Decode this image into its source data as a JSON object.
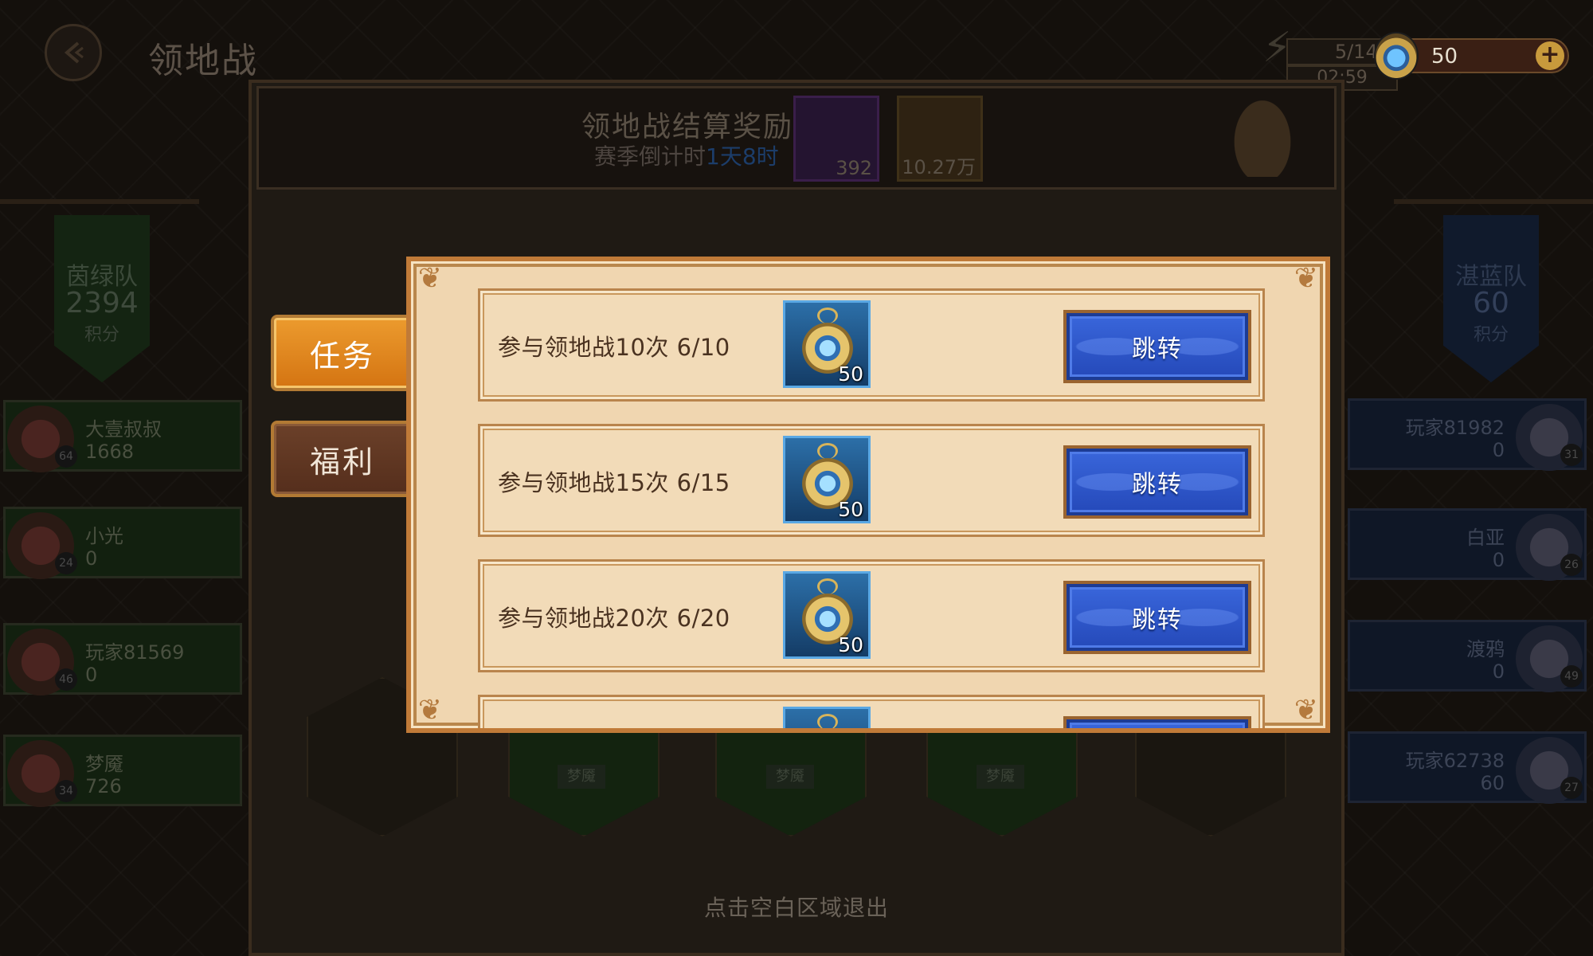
{
  "header": {
    "title": "领地战",
    "energy_count": "5/140",
    "energy_timer": "02:59",
    "currency_value": "50"
  },
  "settlement": {
    "title": "领地战结算奖励",
    "season_label": "赛季倒计时",
    "season_time": "1天8时",
    "rewards": [
      {
        "count": "392",
        "icon": "purple-gem-icon"
      },
      {
        "count": "10.27万",
        "icon": "gold-coin-icon"
      }
    ]
  },
  "teams": {
    "green": {
      "name": "茵绿队",
      "score": "2394",
      "unit": "积分"
    },
    "blue": {
      "name": "湛蓝队",
      "score": "60",
      "unit": "积分"
    }
  },
  "players_green": [
    {
      "name": "大壹叔叔",
      "score": "1668",
      "level": "64"
    },
    {
      "name": "小光",
      "score": "0",
      "level": "24"
    },
    {
      "name": "玩家81569",
      "score": "0",
      "level": "46"
    },
    {
      "name": "梦魇",
      "score": "726",
      "level": "34"
    }
  ],
  "players_blue": [
    {
      "name": "玩家81982",
      "score": "0",
      "level": "31"
    },
    {
      "name": "白亚",
      "score": "0",
      "level": "26"
    },
    {
      "name": "渡鸦",
      "score": "0",
      "level": "49"
    },
    {
      "name": "玩家62738",
      "score": "60",
      "level": "27"
    }
  ],
  "hex_labels": [
    "梦魇",
    "梦魇",
    "梦魇"
  ],
  "tabs": [
    {
      "label": "任务",
      "active": true
    },
    {
      "label": "福利",
      "active": false
    }
  ],
  "tasks": [
    {
      "desc": "参与领地战10次 6/10",
      "reward_qty": "50",
      "button": "跳转"
    },
    {
      "desc": "参与领地战15次 6/15",
      "reward_qty": "50",
      "button": "跳转"
    },
    {
      "desc": "参与领地战20次 6/20",
      "reward_qty": "50",
      "button": "跳转"
    }
  ],
  "exit_hint": "点击空白区域退出",
  "colors": {
    "tab_active": "#e58a22",
    "tab_inactive": "#5e3422",
    "panel_bg": "#f0d6b0",
    "button_blue": "#2e5ad0"
  }
}
